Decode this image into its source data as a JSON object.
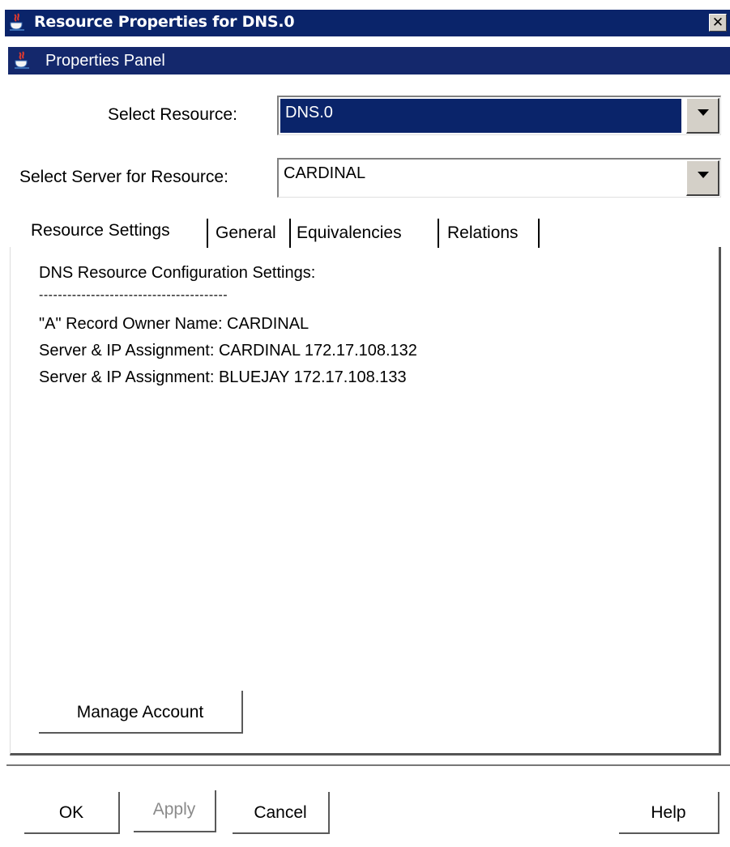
{
  "window": {
    "title": "Resource Properties for DNS.0",
    "close_label": "✕",
    "icon": "java-coffee-icon"
  },
  "panel": {
    "title": "Properties Panel",
    "icon": "java-coffee-icon"
  },
  "form": {
    "resource_label": "Select Resource:",
    "resource_value": "DNS.0",
    "server_label": "Select Server for Resource:",
    "server_value": "CARDINAL"
  },
  "tabs": [
    {
      "label": "Resource Settings",
      "active": true
    },
    {
      "label": "General",
      "active": false
    },
    {
      "label": "Equivalencies",
      "active": false
    },
    {
      "label": "Relations",
      "active": false
    }
  ],
  "content": {
    "heading": "DNS Resource Configuration Settings:",
    "separator": "----------------------------------------",
    "lines": [
      "\"A\" Record Owner Name: CARDINAL",
      "Server & IP Assignment: CARDINAL 172.17.108.132",
      "Server & IP Assignment: BLUEJAY 172.17.108.133"
    ]
  },
  "manage_button": "Manage Account",
  "footer": {
    "ok": "OK",
    "apply": "Apply",
    "cancel": "Cancel",
    "help": "Help"
  },
  "colors": {
    "titlebar": "#0a246a",
    "panelbar": "#14286c",
    "selection": "#0a246a"
  }
}
